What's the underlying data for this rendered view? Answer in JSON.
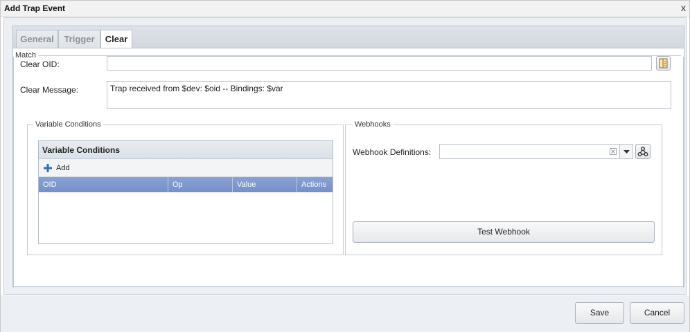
{
  "dialog": {
    "title": "Add Trap Event",
    "close_label": "x"
  },
  "tabs": [
    {
      "label": "General"
    },
    {
      "label": "Trigger"
    },
    {
      "label": "Clear"
    }
  ],
  "match": {
    "legend": "Match",
    "clear_oid_label": "Clear OID:",
    "clear_oid_value": "",
    "clear_message_label": "Clear Message:",
    "clear_message_value": "Trap received from $dev: $oid -- Bindings: $var"
  },
  "variable_conditions": {
    "legend": "Variable Conditions",
    "grid_title": "Variable Conditions",
    "add_label": "Add",
    "columns": [
      "OID",
      "Op",
      "Value",
      "Actions"
    ]
  },
  "webhooks": {
    "legend": "Webhooks",
    "definitions_label": "Webhook Definitions:",
    "definitions_value": "",
    "test_label": "Test Webhook"
  },
  "footer": {
    "save_label": "Save",
    "cancel_label": "Cancel"
  },
  "colors": {
    "grid_header": "#7f99cf",
    "add_icon": "#2e6fb8"
  }
}
